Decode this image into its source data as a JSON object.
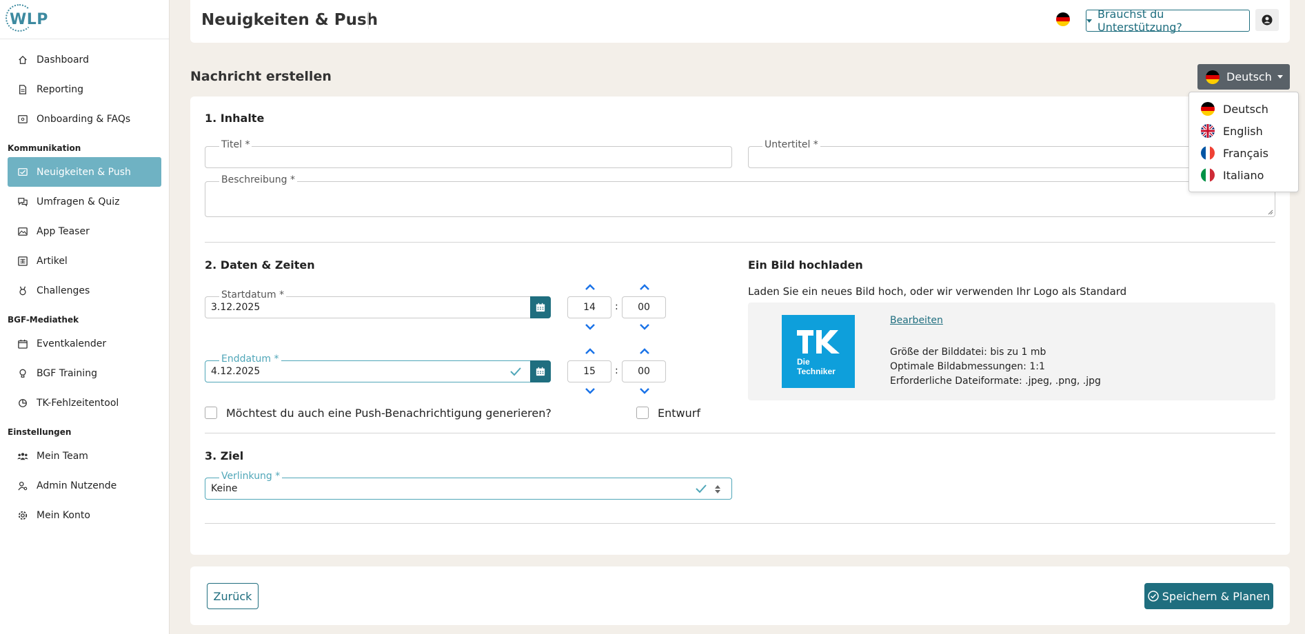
{
  "app": {
    "logo_text": "WLP"
  },
  "sidebar": {
    "top_items": [
      {
        "label": "Dashboard",
        "icon": "home-icon"
      },
      {
        "label": "Reporting",
        "icon": "document-icon"
      },
      {
        "label": "Onboarding & FAQs",
        "icon": "faq-icon"
      }
    ],
    "sections": [
      {
        "title": "Kommunikation",
        "items": [
          {
            "label": "Neuigkeiten & Push",
            "icon": "news-icon",
            "active": true
          },
          {
            "label": "Umfragen & Quiz",
            "icon": "chat-icon"
          },
          {
            "label": "App Teaser",
            "icon": "image-icon"
          },
          {
            "label": "Artikel",
            "icon": "article-icon"
          },
          {
            "label": "Challenges",
            "icon": "trophy-icon"
          }
        ]
      },
      {
        "title": "BGF-Mediathek",
        "items": [
          {
            "label": "Eventkalender",
            "icon": "calendar-icon"
          },
          {
            "label": "BGF Training",
            "icon": "bulb-icon"
          },
          {
            "label": "TK-Fehlzeitentool",
            "icon": "chart-icon"
          }
        ]
      },
      {
        "title": "Einstellungen",
        "items": [
          {
            "label": "Mein Team",
            "icon": "team-icon"
          },
          {
            "label": "Admin Nutzende",
            "icon": "admin-icon"
          },
          {
            "label": "Mein Konto",
            "icon": "gear-icon"
          }
        ]
      }
    ]
  },
  "header": {
    "title": "Neuigkeiten & Push",
    "support_label": "Brauchst du Unterstützung?"
  },
  "page": {
    "section_title": "Nachricht erstellen",
    "language_button": "Deutsch"
  },
  "language_menu": [
    {
      "label": "Deutsch",
      "flag": "de"
    },
    {
      "label": "English",
      "flag": "uk"
    },
    {
      "label": "Français",
      "flag": "fr"
    },
    {
      "label": "Italiano",
      "flag": "it"
    }
  ],
  "form": {
    "section1_title": "1. Inhalte",
    "titel_label": "Titel *",
    "untertitel_label": "Untertitel *",
    "beschreibung_label": "Beschreibung *",
    "section2_title": "2. Daten & Zeiten",
    "startdatum_label": "Startdatum *",
    "startdatum_value": "3.12.2025",
    "start_hour": "14",
    "start_minute": "00",
    "enddatum_label": "Enddatum *",
    "enddatum_value": "4.12.2025",
    "end_hour": "15",
    "end_minute": "00",
    "time_separator": ":",
    "push_label": "Möchtest du auch eine Push-Benachrichtigung generieren?",
    "entwurf_label": "Entwurf",
    "upload_title": "Ein Bild hochladen",
    "upload_hint": "Laden Sie ein neues Bild hoch, oder wir verwenden Ihr Logo als Standard",
    "edit_link": "Bearbeiten",
    "image_info": [
      "Größe der Bilddatei: bis zu 1 mb",
      "Optimale Bildabmessungen: 1:1",
      "Erforderliche Dateiformate: .jpeg, .png, .jpg"
    ],
    "tk_logo_text": [
      "Die",
      "Techniker"
    ],
    "section3_title": "3. Ziel",
    "verlinkung_label": "Verlinkung  *",
    "verlinkung_value": "Keine"
  },
  "footer": {
    "back_label": "Zurück",
    "save_label": "Speichern & Planen"
  },
  "colors": {
    "primary": "#1f6e7f",
    "active_nav": "#6fb2c3",
    "valid": "#4fa6b8",
    "chevron": "#1a73e8",
    "background": "#f3efe9"
  }
}
